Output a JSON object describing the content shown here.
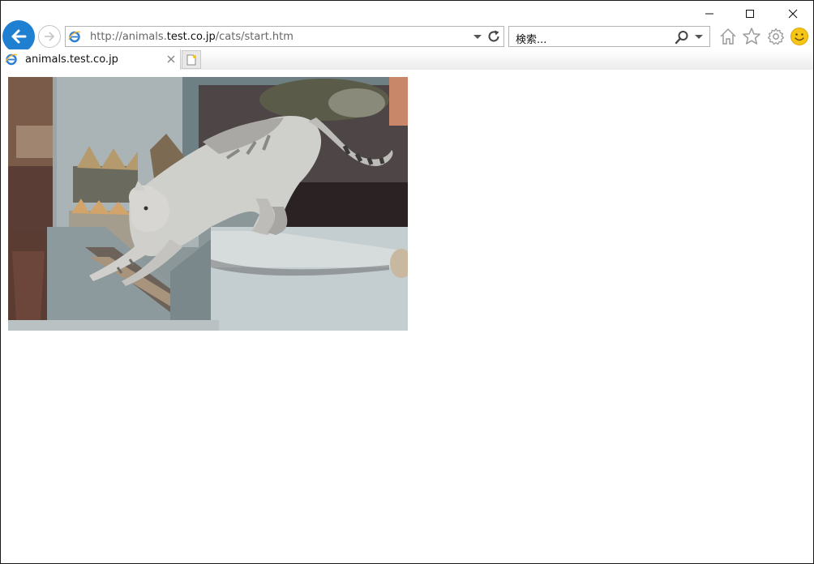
{
  "browser": {
    "address": {
      "prefix": "http://animals.",
      "host": "test.co.jp",
      "path": "/cats/start.htm"
    },
    "search": {
      "text": "検索..."
    },
    "tab": {
      "title": "animals.test.co.jp"
    },
    "icons": {
      "back": "back-arrow-icon",
      "forward": "forward-arrow-icon",
      "refresh": "refresh-icon",
      "search": "magnifier-icon",
      "home": "home-icon",
      "favorites": "star-icon",
      "tools": "gear-icon",
      "feedback": "smiley-icon"
    }
  },
  "colors": {
    "back_button": "#1f7fd0",
    "ie_logo": "#2a7fd4",
    "smiley": "#f5c518"
  }
}
